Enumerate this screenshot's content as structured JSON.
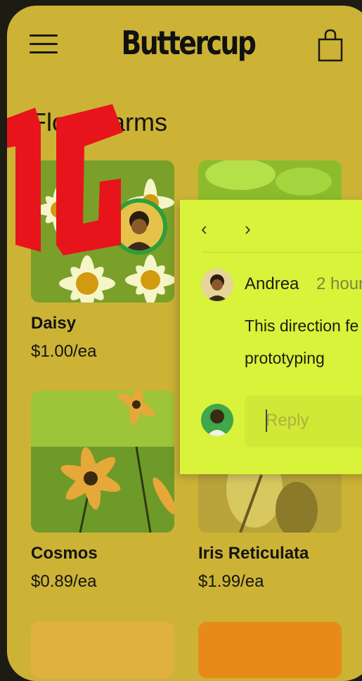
{
  "app": {
    "brand": "Buttercup"
  },
  "section": {
    "title": "Flora Farms"
  },
  "products": [
    {
      "name": "Daisy",
      "price": "$1.00/ea"
    },
    {
      "name": "",
      "price": ""
    },
    {
      "name": "Cosmos",
      "price": "$0.89/ea"
    },
    {
      "name": "Iris Reticulata",
      "price": "$1.99/ea"
    }
  ],
  "comment": {
    "prev_label": "‹",
    "next_label": "›",
    "author": "Andrea",
    "time": "2 hour",
    "text": "This direction fe prototyping",
    "reply_placeholder": "Reply"
  },
  "colors": {
    "background": "#ccb336",
    "popover": "#d9f23a",
    "accent_ring": "#2e9e3a",
    "logo_red": "#e8141b"
  },
  "icons": [
    "menu-icon",
    "shopping-bag-icon",
    "chevron-left-icon",
    "chevron-right-icon"
  ]
}
